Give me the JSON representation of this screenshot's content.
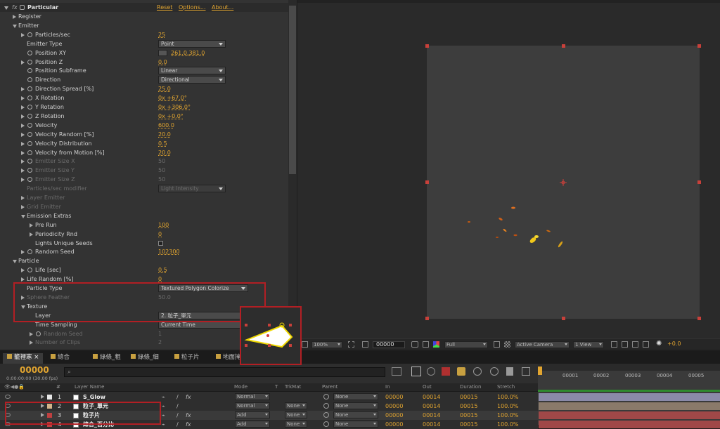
{
  "effect_panel": {
    "fx_label": "fx",
    "effect_name": "Particular",
    "reset": "Reset",
    "options": "Options...",
    "about": "About...",
    "rows": [
      {
        "indent": 0,
        "tri": "closed",
        "label": "Register",
        "stop": false
      },
      {
        "indent": 0,
        "tri": "open",
        "label": "Emitter",
        "stop": false
      },
      {
        "indent": 1,
        "tri": "closed",
        "label": "Particles/sec",
        "stop": true,
        "value": "25"
      },
      {
        "indent": 1,
        "tri": "",
        "label": "Emitter Type",
        "stop": false,
        "dropdown": "Point"
      },
      {
        "indent": 1,
        "tri": "",
        "label": "Position XY",
        "stop": true,
        "value": "261.0,381.0",
        "target": true
      },
      {
        "indent": 1,
        "tri": "closed",
        "label": "Position Z",
        "stop": true,
        "value": "0.0"
      },
      {
        "indent": 1,
        "tri": "",
        "label": "Position Subframe",
        "stop": true,
        "dropdown": "Linear"
      },
      {
        "indent": 1,
        "tri": "",
        "label": "Direction",
        "stop": true,
        "dropdown": "Directional"
      },
      {
        "indent": 1,
        "tri": "closed",
        "label": "Direction Spread [%]",
        "stop": true,
        "value": "25.0"
      },
      {
        "indent": 1,
        "tri": "closed",
        "label": "X Rotation",
        "stop": true,
        "value": "0x +67.0°"
      },
      {
        "indent": 1,
        "tri": "closed",
        "label": "Y Rotation",
        "stop": true,
        "value": "0x +306.0°"
      },
      {
        "indent": 1,
        "tri": "closed",
        "label": "Z Rotation",
        "stop": true,
        "value": "0x +0.0°"
      },
      {
        "indent": 1,
        "tri": "closed",
        "label": "Velocity",
        "stop": true,
        "value": "600.0"
      },
      {
        "indent": 1,
        "tri": "closed",
        "label": "Velocity Random [%]",
        "stop": true,
        "value": "20.0"
      },
      {
        "indent": 1,
        "tri": "closed",
        "label": "Velocity Distribution",
        "stop": true,
        "value": "0.5"
      },
      {
        "indent": 1,
        "tri": "closed",
        "label": "Velocity from Motion [%]",
        "stop": true,
        "value": "20.0"
      },
      {
        "indent": 1,
        "tri": "closed",
        "label": "Emitter Size X",
        "stop": true,
        "value": "50",
        "dim": true
      },
      {
        "indent": 1,
        "tri": "closed",
        "label": "Emitter Size Y",
        "stop": true,
        "value": "50",
        "dim": true
      },
      {
        "indent": 1,
        "tri": "closed",
        "label": "Emitter Size Z",
        "stop": true,
        "value": "50",
        "dim": true
      },
      {
        "indent": 1,
        "tri": "",
        "label": "Particles/sec modifier",
        "stop": false,
        "dropdown": "Light Intensity",
        "dim": true
      },
      {
        "indent": 1,
        "tri": "closed",
        "label": "Layer Emitter",
        "stop": false,
        "dim": true
      },
      {
        "indent": 1,
        "tri": "closed",
        "label": "Grid Emitter",
        "stop": false,
        "dim": true
      },
      {
        "indent": 1,
        "tri": "open",
        "label": "Emission Extras",
        "stop": false
      },
      {
        "indent": 2,
        "tri": "closed",
        "label": "Pre Run",
        "stop": false,
        "value": "100"
      },
      {
        "indent": 2,
        "tri": "closed",
        "label": "Periodicity Rnd",
        "stop": false,
        "value": "0"
      },
      {
        "indent": 2,
        "tri": "",
        "label": "Lights Unique Seeds",
        "stop": false,
        "checkbox": true
      },
      {
        "indent": 1,
        "tri": "closed",
        "label": "Random Seed",
        "stop": true,
        "value": "102300"
      },
      {
        "indent": 0,
        "tri": "open",
        "label": "Particle",
        "stop": false
      },
      {
        "indent": 1,
        "tri": "closed",
        "label": "Life [sec]",
        "stop": true,
        "value": "0.5"
      },
      {
        "indent": 1,
        "tri": "closed",
        "label": "Life Random [%]",
        "stop": false,
        "value": "0"
      },
      {
        "indent": 1,
        "tri": "",
        "label": "Particle Type",
        "stop": false,
        "dropdown": "Textured Polygon Colorize",
        "wide": true
      },
      {
        "indent": 1,
        "tri": "closed",
        "label": "Sphere Feather",
        "stop": false,
        "value": "50.0",
        "dim": true
      },
      {
        "indent": 1,
        "tri": "open",
        "label": "Texture",
        "stop": false
      },
      {
        "indent": 2,
        "tri": "",
        "label": "Layer",
        "stop": false,
        "dropdown": "2. 粒子_單元",
        "wide": true
      },
      {
        "indent": 2,
        "tri": "",
        "label": "Time Sampling",
        "stop": false,
        "dropdown": "Current Time",
        "wide": true
      },
      {
        "indent": 2,
        "tri": "closed",
        "label": "Random Seed",
        "stop": true,
        "value": "1",
        "dim": true
      },
      {
        "indent": 2,
        "tri": "closed",
        "label": "Number of Clips",
        "stop": false,
        "value": "2",
        "dim": true
      }
    ]
  },
  "viewer": {
    "zoom": "100%",
    "timecode": "00000",
    "resolution": "Full",
    "camera": "Active Camera",
    "views": "1 View",
    "exposure": "+0.0"
  },
  "tabs": [
    "籠裡寒",
    "總合",
    "綠條_粗",
    "綠條_細",
    "粒子片",
    "地面掩"
  ],
  "timeline": {
    "time": "00000",
    "fps": "0:00:00:00 (30.00 fps)",
    "search_placeholder": "",
    "headers": {
      "num": "#",
      "name": "Layer Name",
      "mode": "Mode",
      "t": "T",
      "trkmat": "TrkMat",
      "parent": "Parent",
      "in": "In",
      "out": "Out",
      "duration": "Duration",
      "stretch": "Stretch"
    },
    "layers": [
      {
        "num": "1",
        "name": "S_Glow",
        "mode": "Normal",
        "trkmat": "",
        "parent": "None",
        "in": "00000",
        "out": "00014",
        "duration": "00015",
        "stretch": "100.0%",
        "color": "#e8e8e8",
        "bar": "#8a8aa8"
      },
      {
        "num": "2",
        "name": "粒子_單元",
        "mode": "Normal",
        "trkmat": "None",
        "parent": "None",
        "in": "00000",
        "out": "00014",
        "duration": "00015",
        "stretch": "100.0%",
        "color": "#d4b48a",
        "bar": "#8a7a6a"
      },
      {
        "num": "3",
        "name": "粒子片",
        "mode": "Add",
        "trkmat": "None",
        "parent": "None",
        "in": "00000",
        "out": "00014",
        "duration": "00015",
        "stretch": "100.0%",
        "color": "#c04040",
        "bar": "#a04848"
      },
      {
        "num": "4",
        "name": "總合_百分比",
        "mode": "Add",
        "trkmat": "None",
        "parent": "None",
        "in": "00000",
        "out": "00014",
        "duration": "00015",
        "stretch": "100.0%",
        "color": "#c04040",
        "bar": "#a04848"
      }
    ],
    "ruler": [
      "00001",
      "00002",
      "00003",
      "00004",
      "00005"
    ]
  }
}
